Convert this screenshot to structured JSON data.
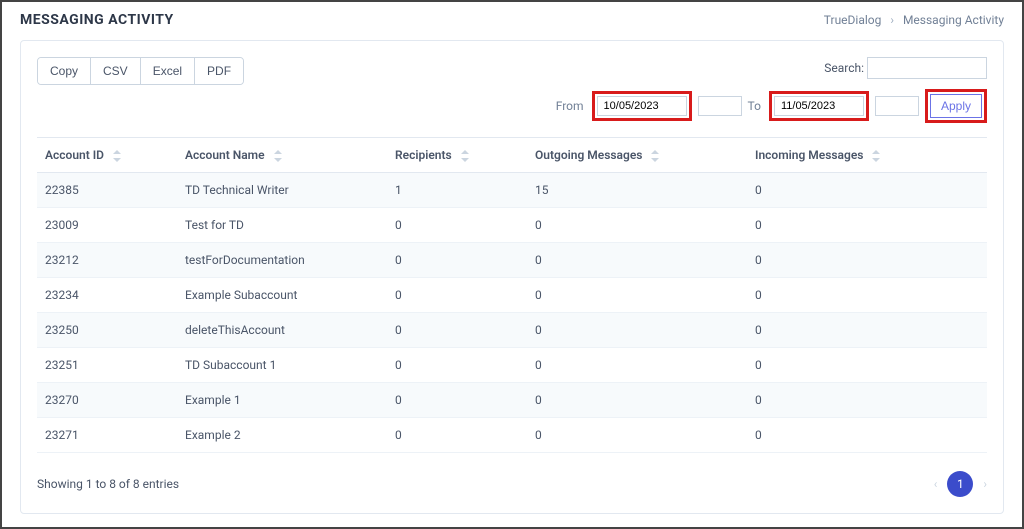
{
  "header": {
    "title": "MESSAGING ACTIVITY",
    "breadcrumb": {
      "root": "TrueDialog",
      "current": "Messaging Activity"
    }
  },
  "export_buttons": {
    "copy": "Copy",
    "csv": "CSV",
    "excel": "Excel",
    "pdf": "PDF"
  },
  "search": {
    "label": "Search:",
    "value": ""
  },
  "date_filter": {
    "from_label": "From",
    "from_value": "10/05/2023",
    "to_label": "To",
    "to_value": "11/05/2023",
    "apply_label": "Apply"
  },
  "table": {
    "columns": {
      "account_id": "Account ID",
      "account_name": "Account Name",
      "recipients": "Recipients",
      "outgoing": "Outgoing Messages",
      "incoming": "Incoming Messages"
    },
    "rows": [
      {
        "account_id": "22385",
        "account_name": "TD Technical Writer",
        "recipients": "1",
        "outgoing": "15",
        "incoming": "0"
      },
      {
        "account_id": "23009",
        "account_name": "Test for TD",
        "recipients": "0",
        "outgoing": "0",
        "incoming": "0"
      },
      {
        "account_id": "23212",
        "account_name": "testForDocumentation",
        "recipients": "0",
        "outgoing": "0",
        "incoming": "0"
      },
      {
        "account_id": "23234",
        "account_name": "Example Subaccount",
        "recipients": "0",
        "outgoing": "0",
        "incoming": "0"
      },
      {
        "account_id": "23250",
        "account_name": "deleteThisAccount",
        "recipients": "0",
        "outgoing": "0",
        "incoming": "0"
      },
      {
        "account_id": "23251",
        "account_name": "TD Subaccount 1",
        "recipients": "0",
        "outgoing": "0",
        "incoming": "0"
      },
      {
        "account_id": "23270",
        "account_name": "Example 1",
        "recipients": "0",
        "outgoing": "0",
        "incoming": "0"
      },
      {
        "account_id": "23271",
        "account_name": "Example 2",
        "recipients": "0",
        "outgoing": "0",
        "incoming": "0"
      }
    ]
  },
  "footer": {
    "info": "Showing 1 to 8 of 8 entries",
    "current_page": "1"
  }
}
